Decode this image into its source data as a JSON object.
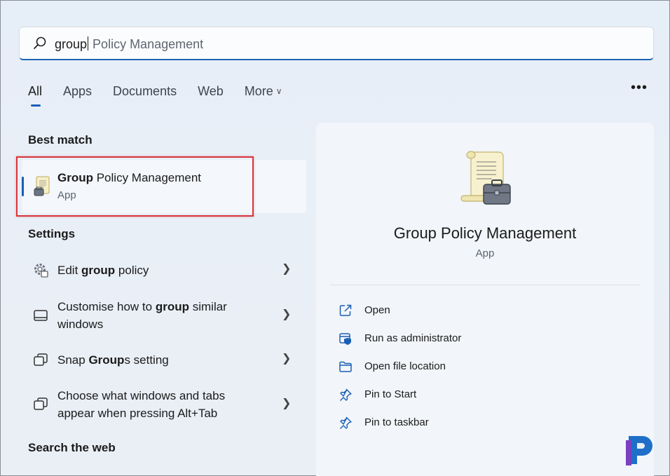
{
  "search": {
    "typed": "group",
    "suggestion": " Policy Management"
  },
  "tabs": [
    {
      "label": "All",
      "active": true
    },
    {
      "label": "Apps"
    },
    {
      "label": "Documents"
    },
    {
      "label": "Web"
    },
    {
      "label": "More"
    }
  ],
  "more_options": "•••",
  "best_match": {
    "heading": "Best match",
    "name_bold": "Group",
    "name_rest": " Policy Management",
    "type": "App"
  },
  "settings": {
    "heading": "Settings",
    "items": [
      {
        "pre": "Edit ",
        "bold": "group",
        "post": " policy",
        "icon": "gear-icon"
      },
      {
        "pre": "Customise how to ",
        "bold": "group",
        "post": " similar windows",
        "icon": "taskbar-icon"
      },
      {
        "pre": "Snap ",
        "bold": "Group",
        "post": "s setting",
        "icon": "snap-icon"
      },
      {
        "pre": "Choose what windows and tabs appear when pressing Alt+Tab",
        "bold": "",
        "post": "",
        "icon": "windows-icon"
      }
    ]
  },
  "search_web": {
    "heading": "Search the web"
  },
  "detail": {
    "title": "Group Policy Management",
    "type": "App",
    "actions": [
      {
        "label": "Open",
        "icon": "open-external-icon"
      },
      {
        "label": "Run as administrator",
        "icon": "shield-icon"
      },
      {
        "label": "Open file location",
        "icon": "folder-icon"
      },
      {
        "label": "Pin to Start",
        "icon": "pin-icon"
      },
      {
        "label": "Pin to taskbar",
        "icon": "pin-icon"
      }
    ]
  },
  "colors": {
    "accent": "#1a5fb4",
    "highlight_box": "#d9353a"
  }
}
